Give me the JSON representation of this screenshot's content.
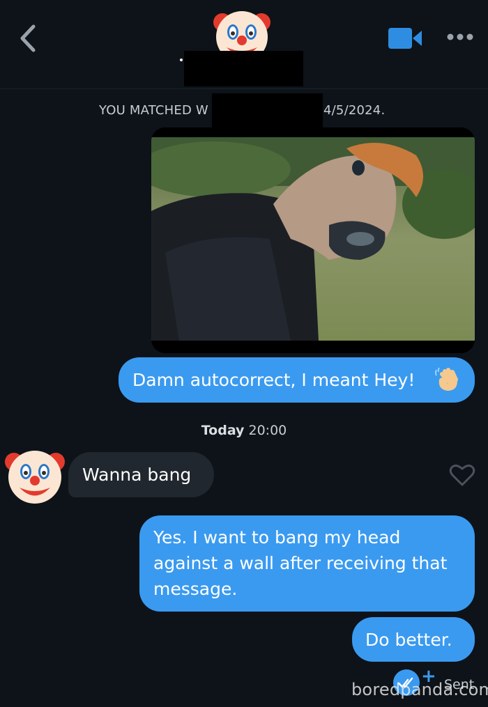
{
  "header": {
    "back_icon": "chevron-left-icon",
    "avatar_icon": "clown-face-icon",
    "video_icon": "video-camera-icon",
    "more_icon": "more-dots-icon",
    "name_redacted": true
  },
  "match_banner": {
    "left_text": "YOU MATCHED W",
    "right_text": "4/5/2024."
  },
  "messages": [
    {
      "direction": "outgoing",
      "type": "gif",
      "description_icon": "horse-mask-gif"
    },
    {
      "direction": "outgoing",
      "type": "text",
      "text": "Damn autocorrect, I meant Hey!",
      "emoji_icon": "waving-hand-icon"
    },
    {
      "direction": "incoming",
      "type": "text",
      "text": "Wanna bang",
      "avatar_icon": "clown-face-icon",
      "like_icon": "heart-outline-icon"
    },
    {
      "direction": "outgoing",
      "type": "text",
      "lines": [
        "Yes. I want to bang my head",
        "against a wall after receiving that",
        "message."
      ]
    },
    {
      "direction": "outgoing",
      "type": "text",
      "text": "Do better."
    }
  ],
  "timestamp": {
    "day": "Today",
    "time": "20:00"
  },
  "status": {
    "icon": "sent-check-icon",
    "plus": "+",
    "label": "Sent"
  },
  "watermark": "boredpanda.com",
  "colors": {
    "background": "#0d1318",
    "outgoing_bubble": "#3a9af0",
    "incoming_bubble": "#20272e",
    "accent": "#3a9af0"
  }
}
